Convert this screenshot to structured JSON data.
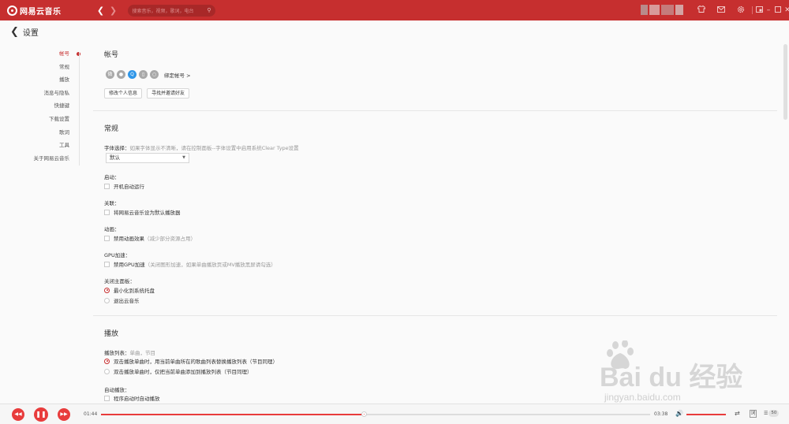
{
  "topbar": {
    "app_name": "网易云音乐",
    "back_icon": "chevron-left-icon",
    "forward_icon": "chevron-right-icon",
    "search_placeholder": "搜索音乐，视频，歌词，电台",
    "search_icon": "search-icon",
    "icons": [
      "shirt-icon",
      "mail-icon",
      "gear-icon"
    ],
    "window_controls": [
      "mini-mode-icon",
      "minimize-icon",
      "maximize-icon",
      "close-icon"
    ],
    "accent": "#c62f2f"
  },
  "header": {
    "title": "设置"
  },
  "sidebar": {
    "items": [
      {
        "label": "帐号",
        "active": true
      },
      {
        "label": "常规"
      },
      {
        "label": "播放"
      },
      {
        "label": "消息与隐私"
      },
      {
        "label": "快捷键"
      },
      {
        "label": "下载设置"
      },
      {
        "label": "歌词"
      },
      {
        "label": "工具"
      },
      {
        "label": "关于网易云音乐"
      }
    ]
  },
  "account": {
    "title": "帐号",
    "bind_link": "绑定帐号 >",
    "edit_profile": "修改个人信息",
    "find_friends": "寻找并邀请好友"
  },
  "general": {
    "title": "常规",
    "font_label": "字体选择：",
    "font_hint": "如果字体显示不清晰，请在控制面板--字体设置中启用系统Clear Type设置",
    "font_value": "默认",
    "startup_label": "启动：",
    "startup_option": "开机自动运行",
    "assoc_label": "关联：",
    "assoc_option": "将网易云音乐设为默认播放器",
    "anim_label": "动画：",
    "anim_option": "禁用动画效果",
    "anim_hint": "（减少部分资源占用）",
    "gpu_label": "GPU加速：",
    "gpu_option": "禁用GPU加速",
    "gpu_hint": "（关闭图形加速，如果单曲播放页或MV播放黑屏请勾选）",
    "close_label": "关闭主面板：",
    "close_opt1": "最小化到系统托盘",
    "close_opt2": "退出云音乐"
  },
  "playback": {
    "title": "播放",
    "list_label": "播放列表：",
    "list_hint": "单曲，节目",
    "list_opt1": "双击播放单曲时，用当前单曲所在的歌曲列表替换播放列表（节目同理）",
    "list_opt2": "双击播放单曲时，仅把当前单曲添加到播放列表（节目同理）",
    "auto_label": "自动播放：",
    "auto_option": "程序启动时自动播放"
  },
  "player": {
    "prev_icon": "prev-icon",
    "play_icon": "pause-icon",
    "next_icon": "next-icon",
    "current_time": "01:44",
    "total_time": "03:38",
    "progress": 0.48,
    "volume": 1.0,
    "volume_icon": "volume-icon",
    "mode_icon": "shuffle-icon",
    "lyric_btn": "词",
    "playlist_icon": "playlist-icon",
    "playlist_count": "50"
  },
  "watermark": {
    "brand": "Bai du 经验",
    "url": "jingyan.baidu.com"
  }
}
